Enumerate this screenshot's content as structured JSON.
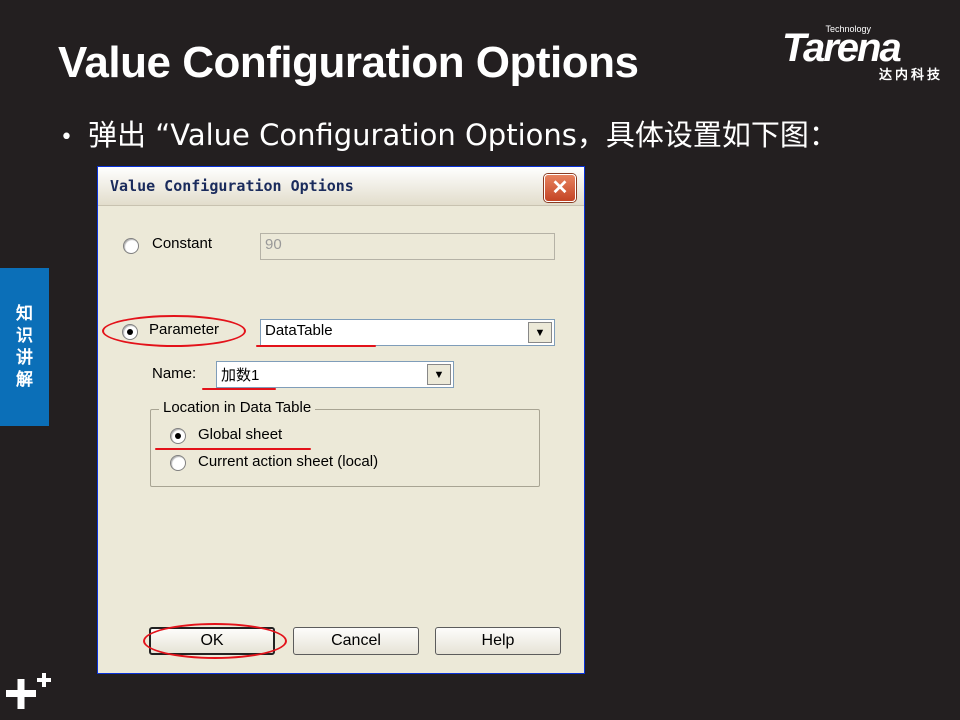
{
  "slide": {
    "title": "Value Configuration Options",
    "bullet": "弹出 “Value Configuration Options，具体设置如下图：",
    "side_tab_chars": [
      "知",
      "识",
      "讲",
      "解"
    ]
  },
  "logo": {
    "technology": "Technology",
    "word": "Tarena",
    "cn": "达内科技"
  },
  "dialog": {
    "title": "Value Configuration Options",
    "close_symbol": "✕",
    "constant_label": "Constant",
    "constant_value": "90",
    "parameter_label": "Parameter",
    "parameter_value": "DataTable",
    "name_label": "Name:",
    "name_value": "加数1",
    "group_title": "Location in Data Table",
    "global_sheet_label": "Global sheet",
    "current_sheet_label": "Current action sheet (local)",
    "ok_label": "OK",
    "cancel_label": "Cancel",
    "help_label": "Help",
    "dropdown_arrow": "▼"
  },
  "colors": {
    "background": "#231f20",
    "side_tab": "#0b6fb8",
    "annotation_red": "#e3121a",
    "dialog_face": "#ece9d8"
  }
}
